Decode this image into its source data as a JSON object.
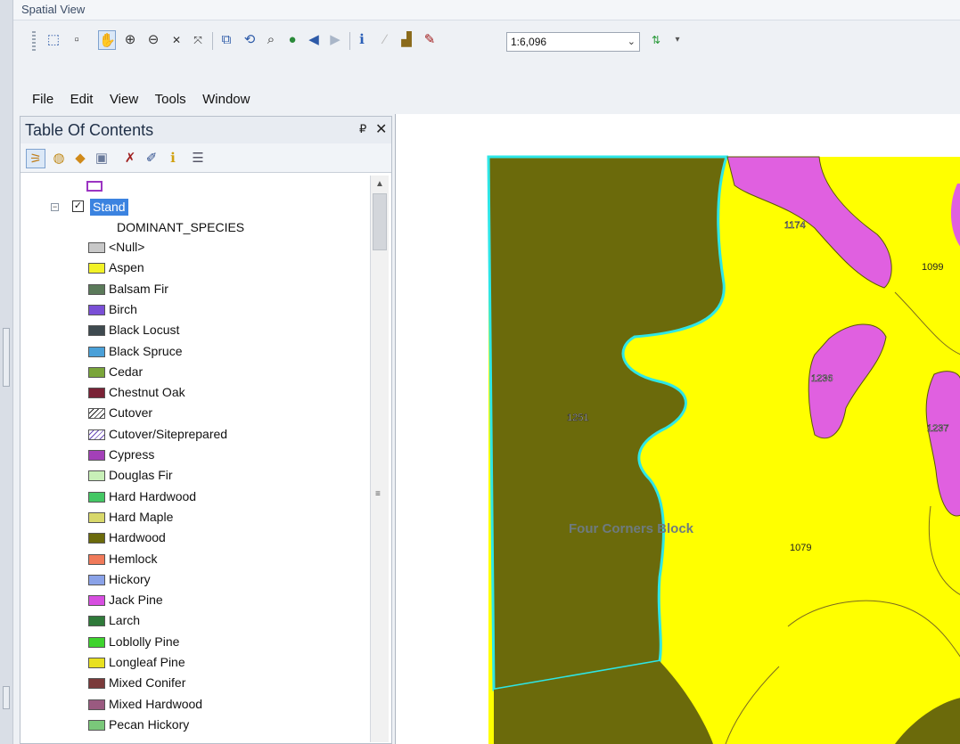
{
  "window": {
    "title": "Spatial View"
  },
  "toolbar": {
    "scale_value": "1:6,096",
    "icons": [
      "select-features-icon",
      "clear-selection-icon",
      "pan-icon",
      "zoom-in-icon",
      "zoom-out-icon",
      "fixed-zoom-in-icon",
      "fixed-zoom-out-icon",
      "select-elements-icon",
      "select-by-lasso-icon",
      "find-icon",
      "globe-icon",
      "back-extent-icon",
      "forward-extent-icon",
      "identify-icon",
      "edit-vertices-icon",
      "measure-icon",
      "edit-pencil-icon",
      "refresh-icon",
      "toolbar-options-icon"
    ]
  },
  "menu": [
    "File",
    "Edit",
    "View",
    "Tools",
    "Window"
  ],
  "toc": {
    "title": "Table Of Contents",
    "pin": "₽",
    "close": "✕",
    "layer_name": "Stand",
    "field_name": "DOMINANT_SPECIES",
    "legend": [
      {
        "label": "<Null>",
        "color": "#c8c8c8"
      },
      {
        "label": "Aspen",
        "color": "#f2f227"
      },
      {
        "label": "Balsam Fir",
        "color": "#5b7a5a"
      },
      {
        "label": "Birch",
        "color": "#7a4fd6"
      },
      {
        "label": "Black Locust",
        "color": "#3e4a4f"
      },
      {
        "label": "Black Spruce",
        "color": "#4aa0d8"
      },
      {
        "label": "Cedar",
        "color": "#7aa53a"
      },
      {
        "label": "Chestnut Oak",
        "color": "#7a2236"
      },
      {
        "label": "Cutover",
        "color": "hatch"
      },
      {
        "label": "Cutover/Siteprepared",
        "color": "hatch-purple"
      },
      {
        "label": "Cypress",
        "color": "#a340b8"
      },
      {
        "label": "Douglas Fir",
        "color": "#c8f0b8"
      },
      {
        "label": "Hard Hardwood",
        "color": "#44c764"
      },
      {
        "label": "Hard Maple",
        "color": "#d8d86a"
      },
      {
        "label": "Hardwood",
        "color": "#6b6a0b"
      },
      {
        "label": "Hemlock",
        "color": "#f07a5a"
      },
      {
        "label": "Hickory",
        "color": "#8aa2e8"
      },
      {
        "label": "Jack Pine",
        "color": "#d74ee0"
      },
      {
        "label": "Larch",
        "color": "#2f7a3a"
      },
      {
        "label": "Loblolly Pine",
        "color": "#3ed32e"
      },
      {
        "label": "Longleaf Pine",
        "color": "#e8e020"
      },
      {
        "label": "Mixed Conifer",
        "color": "#7a3a3a"
      },
      {
        "label": "Mixed Hardwood",
        "color": "#9a5a80"
      },
      {
        "label": "Pecan Hickory",
        "color": "#7ac87a"
      }
    ]
  },
  "map": {
    "labels": [
      "1174",
      "1099",
      "1236",
      "1237",
      "1251",
      "1079",
      "Four Corners Block"
    ],
    "colors": {
      "hardwood": "#6b6a0b",
      "aspen": "#ffff00",
      "jack_pine": "#e060e0",
      "selection": "#2ee6e6"
    }
  }
}
